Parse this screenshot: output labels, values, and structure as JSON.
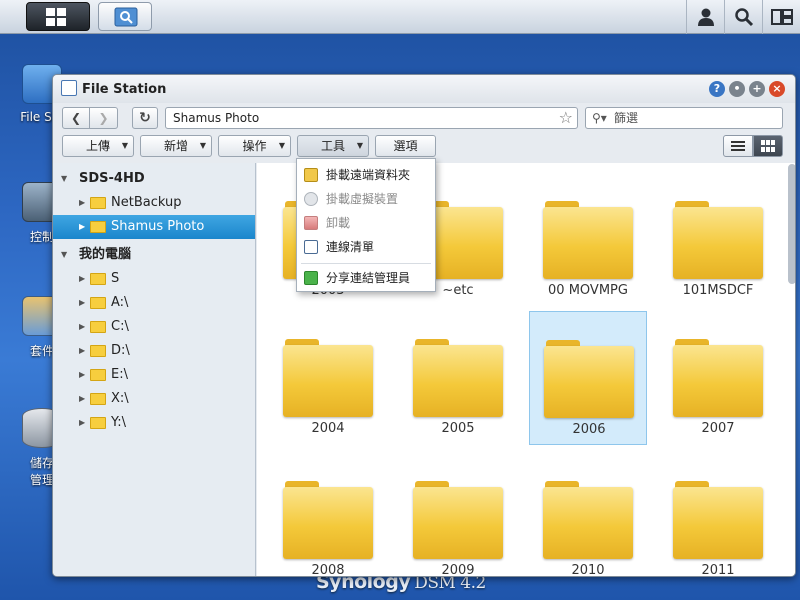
{
  "taskbar": {
    "main_menu_icon": "grid-menu-icon",
    "file_station_task_icon": "file-station-icon",
    "user_icon": "user-icon",
    "search_icon": "search-icon",
    "widgets_icon": "widgets-icon"
  },
  "desktop": {
    "icons": [
      {
        "label": "File Sta",
        "icon": "file-station-icon"
      },
      {
        "label": "控制",
        "icon": "control-panel-icon"
      },
      {
        "label": "套件",
        "icon": "package-center-icon"
      },
      {
        "label": "儲存",
        "label2": "管理",
        "icon": "storage-manager-icon"
      }
    ],
    "brand": "Synology",
    "brand_product": "DSM 4.2"
  },
  "window": {
    "title": "File Station",
    "controls": [
      "help-icon",
      "pin-icon",
      "maximize-icon",
      "close-icon"
    ],
    "path": "Shamus Photo",
    "filter_placeholder": "篩選",
    "toolbar": {
      "upload": "上傳",
      "create": "新增",
      "action": "操作",
      "tools": "工具",
      "settings": "選項"
    },
    "tree": {
      "server": "SDS-4HD",
      "shares": [
        "NetBackup",
        "Shamus Photo"
      ],
      "selected": "Shamus Photo",
      "my_computer": "我的電腦",
      "drives": [
        "S",
        "A:\\",
        "C:\\",
        "D:\\",
        "E:\\",
        "X:\\",
        "Y:\\"
      ]
    },
    "folders": [
      {
        "name": "2003"
      },
      {
        "name": "~etc"
      },
      {
        "name": "00 MOVMPG"
      },
      {
        "name": "101MSDCF"
      },
      {
        "name": "2004"
      },
      {
        "name": "2005"
      },
      {
        "name": "2006",
        "selected": true
      },
      {
        "name": "2007"
      },
      {
        "name": "2008"
      },
      {
        "name": "2009"
      },
      {
        "name": "2010"
      },
      {
        "name": "2011"
      }
    ],
    "tools_menu": [
      {
        "label": "掛載遠端資料夾",
        "icon": "mount-remote-folder-icon",
        "enabled": true
      },
      {
        "label": "掛載虛擬裝置",
        "icon": "mount-virtual-drive-icon",
        "enabled": false
      },
      {
        "label": "卸載",
        "icon": "unmount-icon",
        "enabled": false
      },
      {
        "label": "連線清單",
        "icon": "connection-list-icon",
        "enabled": true
      },
      {
        "label": "分享連結管理員",
        "icon": "share-link-icon",
        "enabled": true
      }
    ]
  }
}
